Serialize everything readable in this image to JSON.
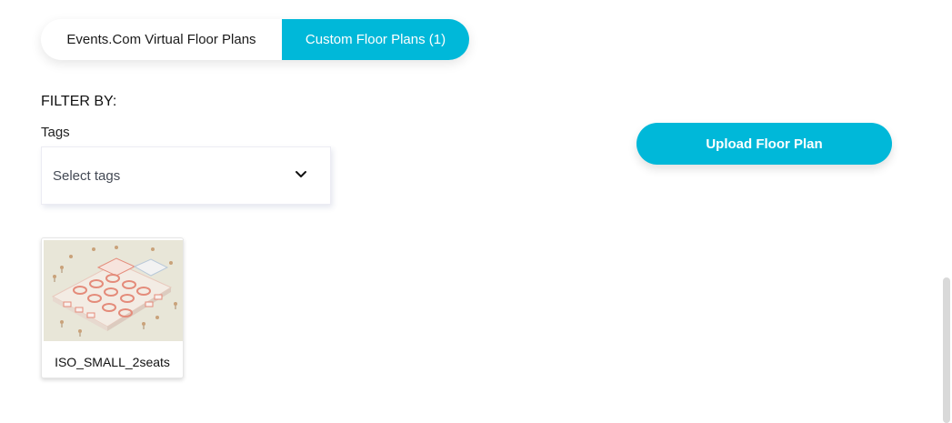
{
  "tabs": {
    "virtual_label": "Events.Com Virtual Floor Plans",
    "custom_label": "Custom Floor Plans (1)"
  },
  "filter": {
    "heading": "FILTER BY:",
    "tags_label": "Tags",
    "tags_placeholder": "Select tags"
  },
  "actions": {
    "upload_label": "Upload Floor Plan"
  },
  "floor_plans": [
    {
      "name": "ISO_SMALL_2seats"
    }
  ],
  "colors": {
    "accent": "#00b8d9",
    "thumb_bg": "#e8e6d8",
    "floor_accent": "#e48b7a"
  },
  "icons": {
    "dropdown": "chevron-down-icon"
  }
}
